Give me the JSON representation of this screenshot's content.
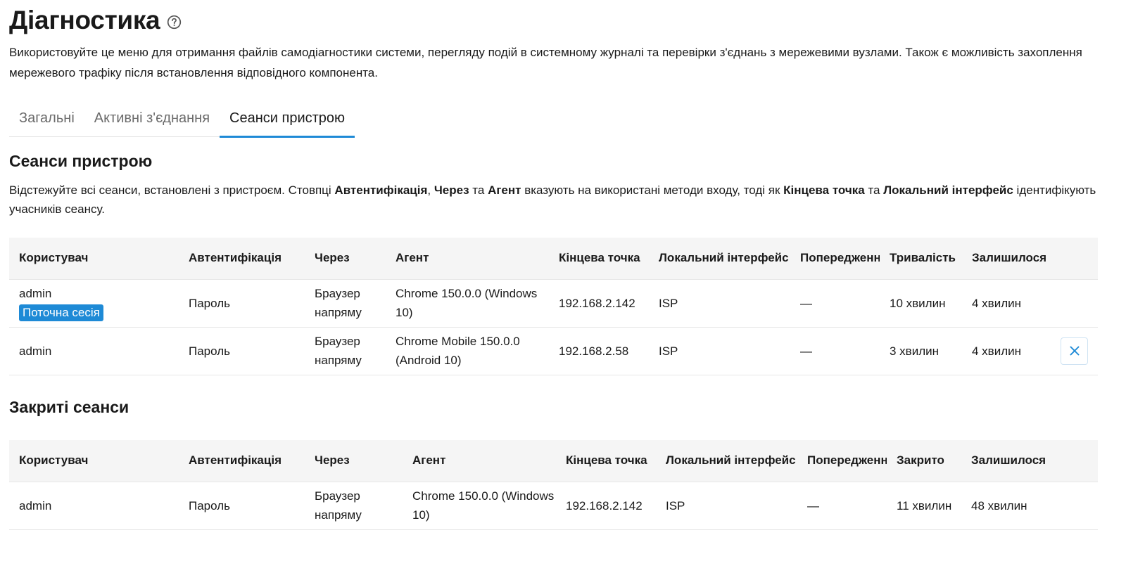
{
  "header": {
    "title": "Діагностика",
    "description": "Використовуйте це меню для отримання файлів самодіагностики системи, перегляду подій в системному журналі та перевірки з'єднань з мережевими вузлами. Також є можливість захоплення мережевого трафіку після встановлення відповідного компонента."
  },
  "tabs": [
    {
      "label": "Загальні"
    },
    {
      "label": "Активні з'єднання"
    },
    {
      "label": "Сеанси пристрою"
    }
  ],
  "active_tab": "Сеанси пристрою",
  "sessions": {
    "title": "Сеанси пристрою",
    "desc": {
      "p1": "Відстежуйте всі сеанси, встановлені з пристроєм. Стовпці ",
      "b1": "Автентифікація",
      "p2": ", ",
      "b2": "Через",
      "p3": " та ",
      "b3": "Агент",
      "p4": " вказують на використані методи входу, тоді як ",
      "b4": "Кінцева точка",
      "p5": " та ",
      "b5": "Локальний інтерфейс",
      "p6": " ідентифікують учасників сеансу."
    },
    "columns": {
      "user": "Користувач",
      "auth": "Автентифікація",
      "via": "Через",
      "agent": "Агент",
      "endpoint": "Кінцева точка",
      "iface": "Локальний інтерфейс",
      "warnings": "Попередженн",
      "duration": "Тривалість",
      "remaining": "Залишилося"
    },
    "rows": [
      {
        "user": "admin",
        "badge": "Поточна сесія",
        "auth": "Пароль",
        "via": "Браузер напряму",
        "agent": "Chrome 150.0.0 (Windows 10)",
        "endpoint": "192.168.2.142",
        "iface": "ISP",
        "warnings": "—",
        "duration": "10 хвилин",
        "remaining": "4 хвилин"
      },
      {
        "user": "admin",
        "auth": "Пароль",
        "via": "Браузер напряму",
        "agent": "Chrome Mobile 150.0.0 (Android 10)",
        "endpoint": "192.168.2.58",
        "iface": "ISP",
        "warnings": "—",
        "duration": "3 хвилин",
        "remaining": "4 хвилин",
        "close_icon": "close-icon"
      }
    ]
  },
  "closed": {
    "title": "Закриті сеанси",
    "columns": {
      "user": "Користувач",
      "auth": "Автентифікація",
      "via": "Через",
      "agent": "Агент",
      "endpoint": "Кінцева точка",
      "iface": "Локальний інтерфейс",
      "warnings": "Попередженн",
      "closed": "Закрито",
      "remaining": "Залишилося"
    },
    "rows": [
      {
        "user": "admin",
        "auth": "Пароль",
        "via": "Браузер напряму",
        "agent": "Chrome 150.0.0 (Windows 10)",
        "endpoint": "192.168.2.142",
        "iface": "ISP",
        "warnings": "—",
        "closed": "11 хвилин",
        "remaining": "48 хвилин"
      }
    ]
  },
  "colors": {
    "accent": "#1e8ad6",
    "header_bg": "#f5f5f5",
    "muted_tab": "#6b6b6b"
  },
  "icons": {
    "help": "help-circle-icon",
    "close": "close-icon"
  }
}
